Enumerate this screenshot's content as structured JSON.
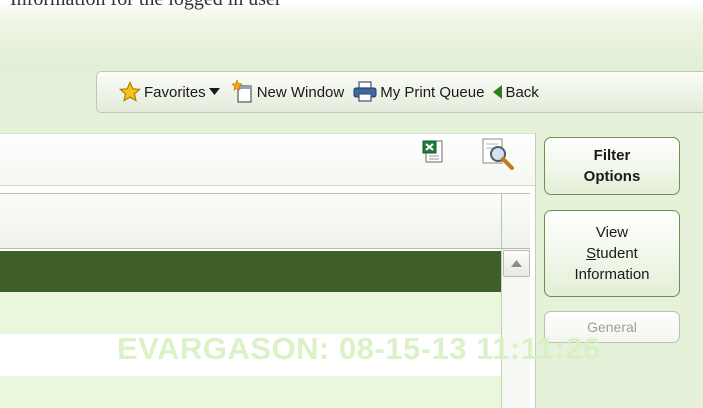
{
  "header": {
    "cut_text": "Information for the logged in user"
  },
  "toolbar": {
    "favorites_label": "Favorites",
    "new_window_label": "New Window",
    "print_queue_label": "My Print Queue",
    "back_label": "Back"
  },
  "report": {
    "export_icon": "excel-export-icon",
    "preview_icon": "print-preview-icon"
  },
  "sidebar": {
    "filter_line1": "Filter",
    "filter_line2": "Options",
    "view_line1": "View",
    "view_line2_underlined": "S",
    "view_line2_rest": "tudent",
    "view_line3": "Information",
    "general_label": "General"
  },
  "watermark": {
    "text": "EVARGASON: 08-15-13 11:11:26"
  },
  "colors": {
    "band": "#e3efd7",
    "selected_row": "#3f5f28",
    "alt_row": "#eaf7dd",
    "button_border": "#6c8f55",
    "watermark": "#d8f0c2"
  }
}
